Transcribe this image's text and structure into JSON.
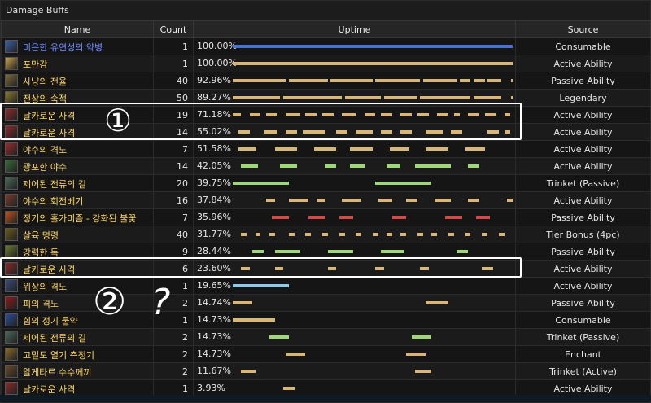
{
  "panel": {
    "title": "Damage Buffs"
  },
  "headers": {
    "name": "Name",
    "count": "Count",
    "uptime": "Uptime",
    "source": "Source"
  },
  "colors": {
    "default_bar": "#d8b67a",
    "name_text": "#ffd66b",
    "first_name_text": "#6f8dff"
  },
  "rows": [
    {
      "name": "미은한 유연성의 약병",
      "icon": "potion-flask-icon",
      "iconColor": "#3d5fa8",
      "count": "1",
      "uptime": "100.00%",
      "source": "Consumable",
      "barColor": "#4a6fd6",
      "segments": [
        [
          0,
          1
        ]
      ]
    },
    {
      "name": "포만감",
      "icon": "food-icon",
      "iconColor": "#c9a24a",
      "count": "1",
      "uptime": "100.00%",
      "source": "Active Ability",
      "segments": [
        [
          0,
          1
        ]
      ]
    },
    {
      "name": "사냥의 전율",
      "icon": "arrow-trail-icon",
      "iconColor": "#7a6a3a",
      "count": "40",
      "uptime": "92.96%",
      "source": "Passive Ability",
      "segments": [
        [
          0,
          0.19
        ],
        [
          0.2,
          0.34
        ],
        [
          0.35,
          0.5
        ],
        [
          0.51,
          0.67
        ],
        [
          0.68,
          0.8
        ],
        [
          0.81,
          0.85
        ],
        [
          0.86,
          0.9
        ],
        [
          0.91,
          0.96
        ],
        [
          0.995,
          1
        ]
      ]
    },
    {
      "name": "전상의 숙적",
      "icon": "legendary-arrow-icon",
      "iconColor": "#8a7a2a",
      "count": "50",
      "uptime": "89.27%",
      "source": "Legendary",
      "segments": [
        [
          0,
          0.17
        ],
        [
          0.18,
          0.39
        ],
        [
          0.4,
          0.53
        ],
        [
          0.54,
          0.66
        ],
        [
          0.67,
          0.85
        ],
        [
          0.86,
          0.96
        ],
        [
          0.995,
          1
        ]
      ]
    },
    {
      "name": "날카로운 사격",
      "icon": "sharp-shot-icon",
      "iconColor": "#8a2a2a",
      "count": "19",
      "uptime": "71.18%",
      "source": "Active Ability",
      "segments": [
        [
          0,
          0.03
        ],
        [
          0.06,
          0.1
        ],
        [
          0.12,
          0.16
        ],
        [
          0.19,
          0.24
        ],
        [
          0.26,
          0.3
        ],
        [
          0.32,
          0.36
        ],
        [
          0.39,
          0.44
        ],
        [
          0.47,
          0.51
        ],
        [
          0.53,
          0.57
        ],
        [
          0.6,
          0.64
        ],
        [
          0.66,
          0.7
        ],
        [
          0.73,
          0.77
        ],
        [
          0.79,
          0.81
        ],
        [
          0.84,
          0.88
        ],
        [
          0.9,
          0.94
        ],
        [
          0.97,
          0.99
        ]
      ]
    },
    {
      "name": "날카로운 사격",
      "icon": "sharp-shot-icon",
      "iconColor": "#8a2a2a",
      "count": "14",
      "uptime": "55.02%",
      "source": "Active Ability",
      "segments": [
        [
          0.02,
          0.06
        ],
        [
          0.11,
          0.16
        ],
        [
          0.19,
          0.23
        ],
        [
          0.25,
          0.33
        ],
        [
          0.37,
          0.41
        ],
        [
          0.44,
          0.5
        ],
        [
          0.53,
          0.57
        ],
        [
          0.6,
          0.64
        ],
        [
          0.69,
          0.75
        ],
        [
          0.78,
          0.82
        ],
        [
          0.91,
          0.95
        ],
        [
          0.97,
          0.99
        ]
      ]
    },
    {
      "name": "야수의 격노",
      "icon": "beast-fury-icon",
      "iconColor": "#9a2a2a",
      "count": "7",
      "uptime": "51.58%",
      "source": "Active Ability",
      "segments": [
        [
          0.02,
          0.08
        ],
        [
          0.15,
          0.23
        ],
        [
          0.29,
          0.37
        ],
        [
          0.42,
          0.5
        ],
        [
          0.56,
          0.63
        ],
        [
          0.69,
          0.77
        ],
        [
          0.83,
          0.9
        ]
      ]
    },
    {
      "name": "광포한 야수",
      "icon": "frenzy-beast-icon",
      "iconColor": "#3a6a3a",
      "count": "14",
      "uptime": "42.05%",
      "source": "Active Ability",
      "barColor": "#9fd67a",
      "segments": [
        [
          0.03,
          0.09
        ],
        [
          0.17,
          0.23
        ],
        [
          0.33,
          0.37
        ],
        [
          0.42,
          0.47
        ],
        [
          0.55,
          0.6
        ],
        [
          0.65,
          0.78
        ],
        [
          0.84,
          0.88
        ]
      ]
    },
    {
      "name": "제어된 전류의 길",
      "icon": "current-path-icon",
      "iconColor": "#4a6a5a",
      "count": "20",
      "uptime": "39.75%",
      "source": "Trinket (Passive)",
      "barColor": "#9fd67a",
      "segments": [
        [
          0,
          0.2
        ],
        [
          0.51,
          0.71
        ]
      ]
    },
    {
      "name": "야수의 회전베기",
      "icon": "beast-cleave-icon",
      "iconColor": "#7a3a2a",
      "count": "16",
      "uptime": "37.84%",
      "source": "Active Ability",
      "segments": [
        [
          0.12,
          0.15
        ],
        [
          0.2,
          0.27
        ],
        [
          0.3,
          0.33
        ],
        [
          0.39,
          0.46
        ],
        [
          0.52,
          0.57
        ],
        [
          0.62,
          0.66
        ],
        [
          0.72,
          0.78
        ],
        [
          0.84,
          0.88
        ],
        [
          0.98,
          1
        ]
      ]
    },
    {
      "name": "정기의 홀가미즘 - 강화된 불꽃",
      "icon": "flame-icon",
      "iconColor": "#c0501a",
      "count": "7",
      "uptime": "35.96%",
      "source": "Passive Ability",
      "barColor": "#d64848",
      "segments": [
        [
          0.14,
          0.2
        ],
        [
          0.27,
          0.33
        ],
        [
          0.38,
          0.43
        ],
        [
          0.57,
          0.62
        ],
        [
          0.76,
          0.82
        ],
        [
          0.87,
          0.92
        ]
      ]
    },
    {
      "name": "살육 명령",
      "icon": "kill-command-icon",
      "iconColor": "#6a5a1a",
      "count": "40",
      "uptime": "31.77%",
      "source": "Tier Bonus (4pc)",
      "segments": [
        [
          0.03,
          0.05
        ],
        [
          0.08,
          0.1
        ],
        [
          0.13,
          0.15
        ],
        [
          0.2,
          0.22
        ],
        [
          0.26,
          0.28
        ],
        [
          0.32,
          0.34
        ],
        [
          0.38,
          0.4
        ],
        [
          0.44,
          0.46
        ],
        [
          0.5,
          0.52
        ],
        [
          0.55,
          0.57
        ],
        [
          0.6,
          0.62
        ],
        [
          0.66,
          0.68
        ],
        [
          0.71,
          0.73
        ],
        [
          0.77,
          0.79
        ],
        [
          0.83,
          0.85
        ],
        [
          0.89,
          0.91
        ],
        [
          0.95,
          0.97
        ]
      ]
    },
    {
      "name": "강력한 독",
      "icon": "poison-icon",
      "iconColor": "#6a7a2a",
      "count": "9",
      "uptime": "28.44%",
      "source": "Passive Ability",
      "barColor": "#9fd67a",
      "segments": [
        [
          0.07,
          0.11
        ],
        [
          0.15,
          0.24
        ],
        [
          0.34,
          0.43
        ],
        [
          0.53,
          0.61
        ],
        [
          0.8,
          0.84
        ]
      ]
    },
    {
      "name": "날카로운 사격",
      "icon": "sharp-shot-icon",
      "iconColor": "#8a2a2a",
      "count": "6",
      "uptime": "23.60%",
      "source": "Active Ability",
      "segments": [
        [
          0.03,
          0.06
        ],
        [
          0.15,
          0.18
        ],
        [
          0.34,
          0.37
        ],
        [
          0.51,
          0.54
        ],
        [
          0.67,
          0.7
        ],
        [
          0.89,
          0.93
        ]
      ]
    },
    {
      "name": "위상의 격노",
      "icon": "aspect-fury-icon",
      "iconColor": "#3a4a7a",
      "count": "1",
      "uptime": "19.65%",
      "source": "Active Ability",
      "barColor": "#8ec9e8",
      "segments": [
        [
          0,
          0.2
        ]
      ]
    },
    {
      "name": "피의 격노",
      "icon": "blood-fury-icon",
      "iconColor": "#8a1a1a",
      "count": "2",
      "uptime": "14.74%",
      "source": "Passive Ability",
      "segments": [
        [
          0,
          0.07
        ],
        [
          0.69,
          0.77
        ]
      ]
    },
    {
      "name": "힘의 정기 물약",
      "icon": "strength-potion-icon",
      "iconColor": "#2a4a9a",
      "count": "1",
      "uptime": "14.73%",
      "source": "Consumable",
      "segments": [
        [
          0,
          0.15
        ]
      ]
    },
    {
      "name": "제어된 전류의 길",
      "icon": "current-path-icon",
      "iconColor": "#4a6a5a",
      "count": "2",
      "uptime": "14.73%",
      "source": "Trinket (Passive)",
      "barColor": "#9fd67a",
      "segments": [
        [
          0.13,
          0.2
        ],
        [
          0.64,
          0.71
        ]
      ]
    },
    {
      "name": "고밀도 열기 측정기",
      "icon": "enchant-icon",
      "iconColor": "#8a6a2a",
      "count": "2",
      "uptime": "14.73%",
      "source": "Enchant",
      "segments": [
        [
          0.19,
          0.26
        ],
        [
          0.62,
          0.69
        ]
      ]
    },
    {
      "name": "알게타르 수수께끼",
      "icon": "puzzle-box-icon",
      "iconColor": "#6a4a2a",
      "count": "2",
      "uptime": "11.67%",
      "source": "Trinket (Active)",
      "segments": [
        [
          0.03,
          0.08
        ],
        [
          0.65,
          0.71
        ]
      ]
    },
    {
      "name": "날카로운 사격",
      "icon": "sharp-shot-icon",
      "iconColor": "#8a2a2a",
      "count": "1",
      "uptime": "3.93%",
      "source": "Active Ability",
      "segments": [
        [
          0.18,
          0.22
        ]
      ]
    }
  ],
  "annotations": {
    "mark1": "①",
    "mark2": "②",
    "mark3": "?"
  }
}
